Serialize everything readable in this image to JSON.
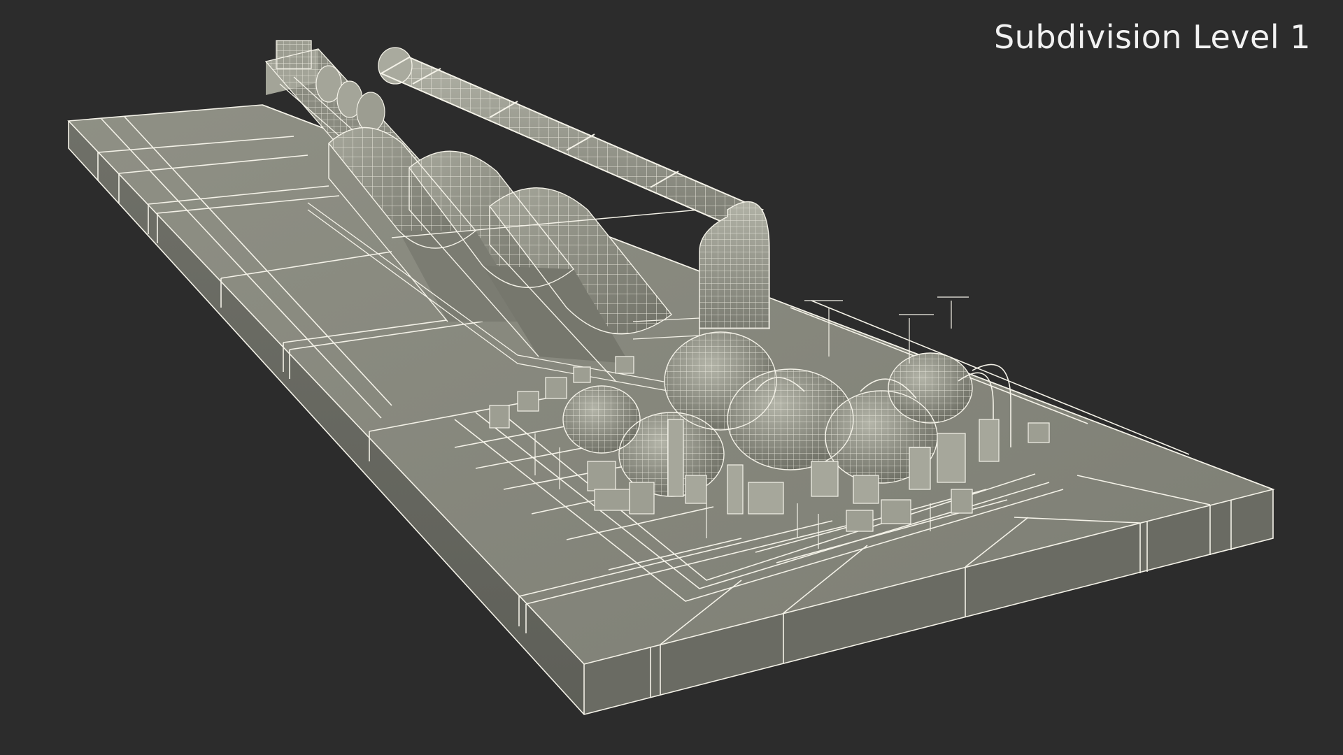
{
  "viewport": {
    "label": "Subdivision Level 1",
    "background_color": "#2c2c2c",
    "label_color": "#f2f2f2"
  },
  "model": {
    "render_mode": "wireframe-on-shaded",
    "base_color": "#8d8e83",
    "wire_color": "#f4f2e8"
  }
}
